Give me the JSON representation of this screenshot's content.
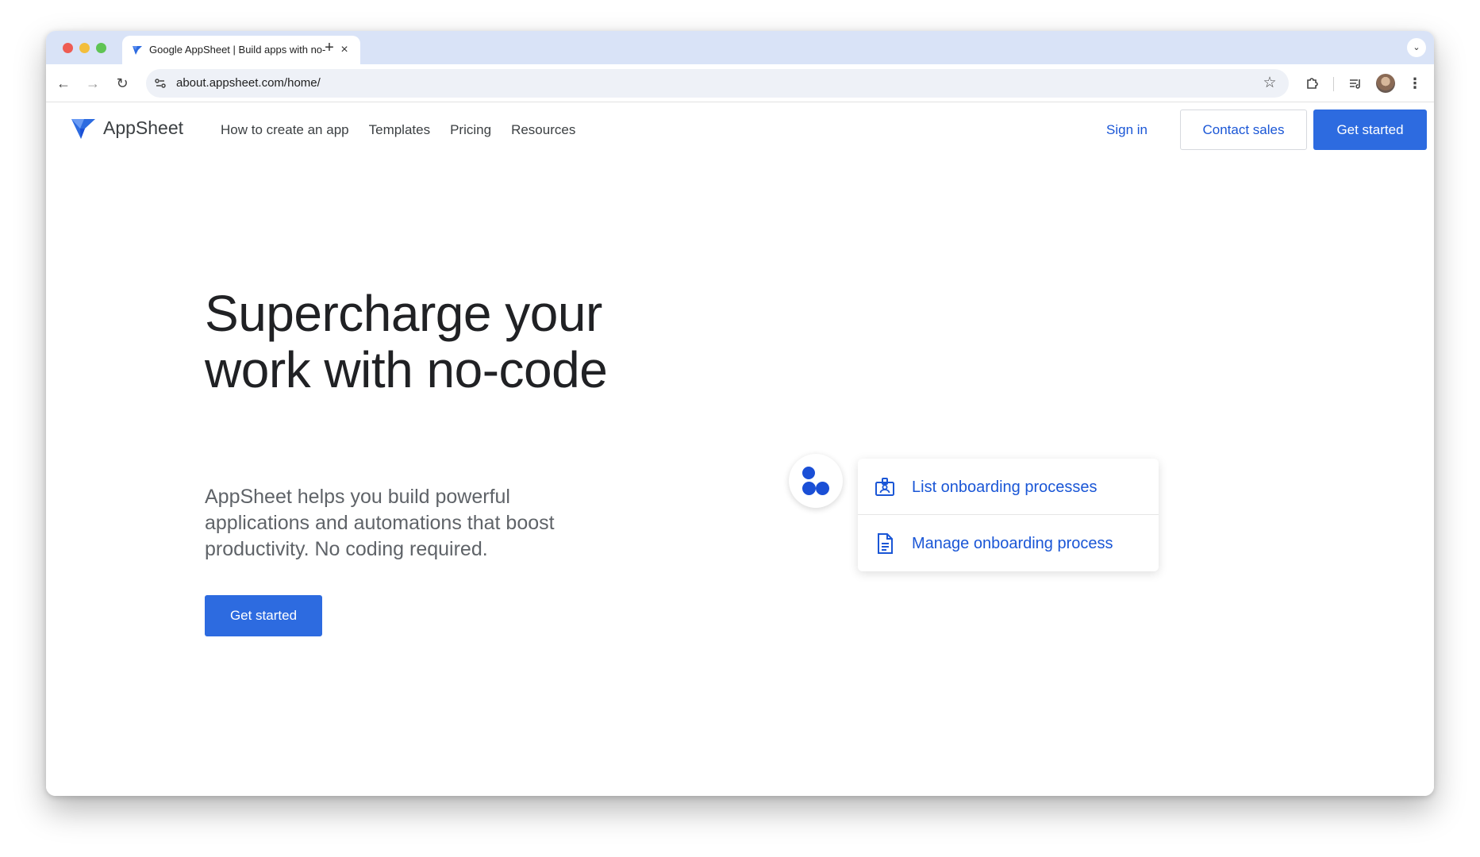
{
  "browser": {
    "tab_title": "Google AppSheet | Build apps with no-code",
    "tab_close": "×",
    "new_tab": "+",
    "url": "about.appsheet.com/home/",
    "icons": [
      "back-icon",
      "forward-icon",
      "reload-icon",
      "site-info-icon",
      "star-icon",
      "extensions-icon",
      "media-icon",
      "profile-icon",
      "menu-icon",
      "tab-search-icon"
    ]
  },
  "header": {
    "brand": "AppSheet",
    "nav": [
      {
        "label": "How to create an app"
      },
      {
        "label": "Templates"
      },
      {
        "label": "Pricing"
      },
      {
        "label": "Resources"
      }
    ],
    "sign_in": "Sign in",
    "contact_sales": "Contact sales",
    "get_started": "Get started"
  },
  "hero": {
    "title": "Supercharge your work with no-code",
    "subtitle": "AppSheet helps you build powerful applications and automations that boost productivity. No coding required.",
    "cta": "Get started"
  },
  "preview": {
    "items": [
      {
        "label": "List onboarding processes",
        "icon": "id-badge-icon"
      },
      {
        "label": "Manage onboarding process",
        "icon": "document-icon"
      }
    ]
  },
  "colors": {
    "accent": "#2d6be0",
    "link": "#1a56d6",
    "tabstrip": "#d9e3f7",
    "bubble_dot": "#1a4fd6"
  }
}
